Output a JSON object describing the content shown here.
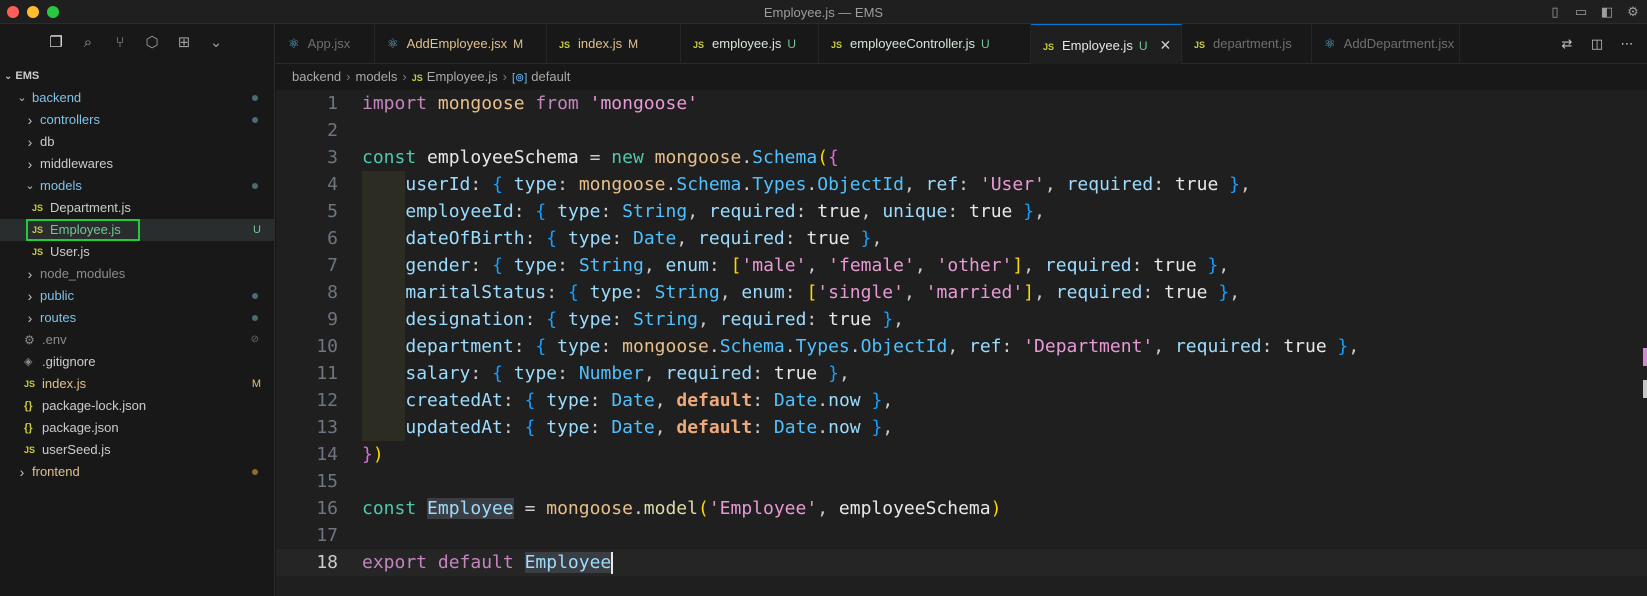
{
  "window": {
    "title": "Employee.js — EMS"
  },
  "explorer": {
    "root": "EMS",
    "items": [
      {
        "label": "backend",
        "kind": "folder-open",
        "depth": 0,
        "status": "dot"
      },
      {
        "label": "controllers",
        "kind": "folder",
        "depth": 1,
        "status": "dot"
      },
      {
        "label": "db",
        "kind": "folder",
        "depth": 1
      },
      {
        "label": "middlewares",
        "kind": "folder",
        "depth": 1
      },
      {
        "label": "models",
        "kind": "folder-open",
        "depth": 1,
        "status": "dot"
      },
      {
        "label": "Department.js",
        "kind": "js",
        "depth": 2
      },
      {
        "label": "Employee.js",
        "kind": "js",
        "depth": 2,
        "status": "U",
        "selected": true
      },
      {
        "label": "User.js",
        "kind": "js",
        "depth": 2
      },
      {
        "label": "node_modules",
        "kind": "folder",
        "depth": 1
      },
      {
        "label": "public",
        "kind": "folder",
        "depth": 1,
        "status": "dot"
      },
      {
        "label": "routes",
        "kind": "folder",
        "depth": 1,
        "status": "dot"
      },
      {
        "label": ".env",
        "kind": "gear",
        "depth": 1,
        "status": "ignored"
      },
      {
        "label": ".gitignore",
        "kind": "git",
        "depth": 1
      },
      {
        "label": "index.js",
        "kind": "js",
        "depth": 1,
        "status": "M"
      },
      {
        "label": "package-lock.json",
        "kind": "json",
        "depth": 1
      },
      {
        "label": "package.json",
        "kind": "json",
        "depth": 1
      },
      {
        "label": "userSeed.js",
        "kind": "js",
        "depth": 1
      },
      {
        "label": "frontend",
        "kind": "folder",
        "depth": 0,
        "status": "dot-orange"
      }
    ],
    "ignored_symbol": "⊘"
  },
  "tabs": [
    {
      "label": "App.jsx",
      "icon": "react",
      "status": ""
    },
    {
      "label": "AddEmployee.jsx",
      "icon": "react",
      "status": "M"
    },
    {
      "label": "index.js",
      "icon": "js",
      "status": "M"
    },
    {
      "label": "employee.js",
      "icon": "js",
      "status": "U"
    },
    {
      "label": "employeeController.js",
      "icon": "js",
      "status": "U"
    },
    {
      "label": "Employee.js",
      "icon": "js",
      "status": "U",
      "active": true
    },
    {
      "label": "department.js",
      "icon": "js",
      "status": ""
    },
    {
      "label": "AddDepartment.jsx",
      "icon": "react",
      "status": ""
    }
  ],
  "breadcrumb": {
    "parts": [
      "backend",
      "models",
      "Employee.js",
      "default"
    ]
  },
  "editor": {
    "line_numbers": [
      "1",
      "2",
      "3",
      "4",
      "5",
      "6",
      "7",
      "8",
      "9",
      "10",
      "11",
      "12",
      "13",
      "14",
      "15",
      "16",
      "17",
      "18"
    ],
    "current_line": 18
  },
  "colors": {
    "accent": "#0078d4",
    "modified": "#e2c08d",
    "untracked": "#73c991",
    "highlight_box": "#1ecc3c"
  }
}
